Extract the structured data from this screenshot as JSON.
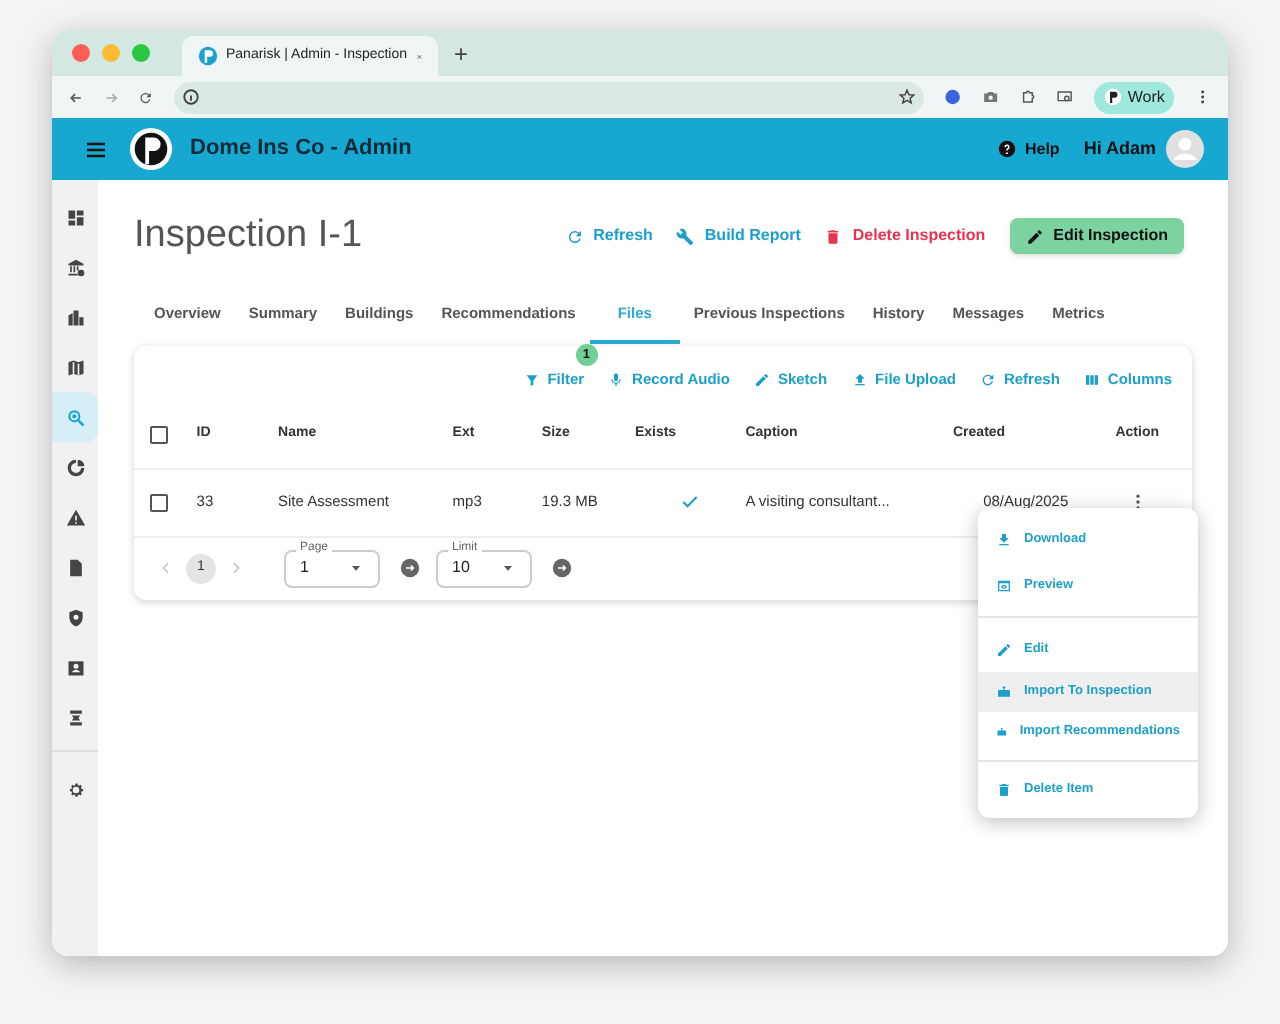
{
  "browser": {
    "tab_title": "Panarisk | Admin - Inspection",
    "new_tab": "+",
    "profile": "Work"
  },
  "app_bar": {
    "title": "Dome Ins Co - Admin",
    "help": "Help",
    "greeting": "Hi Adam"
  },
  "sidebar": {
    "items": [
      {
        "selected": false
      },
      {
        "selected": false
      },
      {
        "selected": false
      },
      {
        "selected": false
      },
      {
        "selected": true
      },
      {
        "selected": false
      },
      {
        "selected": false
      },
      {
        "selected": false
      },
      {
        "selected": false
      },
      {
        "selected": false
      },
      {
        "selected": false
      },
      {
        "selected": false
      }
    ]
  },
  "page": {
    "title": "Inspection I-1",
    "actions": [
      {
        "label": "Refresh",
        "kind": "refresh"
      },
      {
        "label": "Build Report",
        "kind": "wrench"
      },
      {
        "label": "Delete Inspection",
        "kind": "delete"
      },
      {
        "label": "Edit Inspection",
        "kind": "primary"
      }
    ]
  },
  "tabs": [
    {
      "label": "Overview",
      "selected": false
    },
    {
      "label": "Summary",
      "selected": false
    },
    {
      "label": "Buildings",
      "selected": false
    },
    {
      "label": "Recommendations",
      "selected": false
    },
    {
      "label": "Files",
      "selected": true
    },
    {
      "label": "Previous Inspections",
      "selected": false
    },
    {
      "label": "History",
      "selected": false
    },
    {
      "label": "Messages",
      "selected": false
    },
    {
      "label": "Metrics",
      "selected": false
    }
  ],
  "toolbar": [
    {
      "label": "Filter",
      "kind": "filter",
      "badge": "1"
    },
    {
      "label": "Record Audio",
      "kind": "mic"
    },
    {
      "label": "Sketch",
      "kind": "pen"
    },
    {
      "label": "File Upload",
      "kind": "upload"
    },
    {
      "label": "Refresh",
      "kind": "refresh"
    },
    {
      "label": "Columns",
      "kind": "columns"
    }
  ],
  "table": {
    "select_all_checked": false,
    "columns": [
      "ID",
      "Name",
      "Ext",
      "Size",
      "Exists",
      "Caption",
      "Created",
      "Action"
    ],
    "rows": [
      {
        "checked": false,
        "id": "33",
        "name": "Site Assessment",
        "ext": "mp3",
        "size": "19.3 MB",
        "exists": true,
        "caption": "A visiting consultant...",
        "created": "08/Aug/2025"
      }
    ]
  },
  "pagination": {
    "page_number": "1",
    "page_label": "Page",
    "page_value": "1",
    "limit_label": "Limit",
    "limit_value": "10"
  },
  "menu": [
    {
      "label": "Download",
      "kind": "download",
      "selected": false
    },
    {
      "label": "Preview",
      "kind": "preview",
      "selected": false
    },
    {
      "kind": "divider"
    },
    {
      "label": "Edit",
      "kind": "edit",
      "selected": false
    },
    {
      "label": "Import To Inspection",
      "kind": "import",
      "selected": true
    },
    {
      "label": "Import Recommendations",
      "kind": "import",
      "selected": false
    },
    {
      "kind": "divider"
    },
    {
      "label": "Delete Item",
      "kind": "delete",
      "selected": false
    }
  ]
}
